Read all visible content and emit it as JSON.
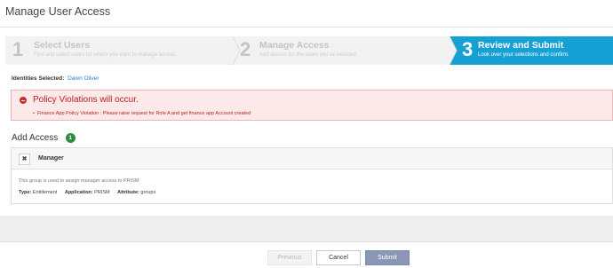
{
  "header": {
    "title": "Manage User Access"
  },
  "wizard": {
    "steps": [
      {
        "number": "1",
        "title": "Select Users",
        "subtitle": "Find and select users for whom you want to manage access."
      },
      {
        "number": "2",
        "title": "Manage Access",
        "subtitle": "Add access for the users you've selected."
      },
      {
        "number": "3",
        "title": "Review and Submit",
        "subtitle": "Look over your selections and confirm."
      }
    ],
    "active_color": "#17a0d3",
    "active_step": 3
  },
  "identities": {
    "label": "Identities Selected:",
    "value": "Dawn Oliver"
  },
  "alert": {
    "title": "Policy Violations will occur.",
    "bullet": "•",
    "message": "Finance App Policy Violation : Please raise request for Role A and get finance app Account created",
    "color": "#b5221c",
    "icon": "minus-circle-icon"
  },
  "add_access": {
    "title": "Add Access",
    "count": "1",
    "items": [
      {
        "remove_icon": "✖",
        "name": "Manager",
        "description": "This group is used to assign manager access to PRISM",
        "type_label": "Type:",
        "type_value": "Entitlement",
        "application_label": "Application:",
        "application_value": "PRISM",
        "attribute_label": "Attribute:",
        "attribute_value": "groups"
      }
    ]
  },
  "footer": {
    "previous_label": "Previous",
    "cancel_label": "Cancel",
    "submit_label": "Submit"
  }
}
